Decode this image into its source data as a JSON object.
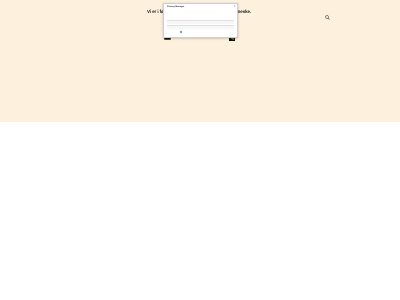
{
  "hero": {
    "headline_left": "Vi er i fø",
    "headline_right": "nneskе."
  },
  "contact": {
    "email": "",
    "phone": "",
    "extra": ""
  },
  "dialog": {
    "title": "Privacy Manager",
    "close": "×",
    "body": "",
    "option_1": "",
    "option_2": "",
    "footer_link": "",
    "check_state": "accepted"
  },
  "colors": {
    "hero_bg": "#fdf1dd",
    "accent": "#2e9e5b",
    "text": "#1a1a1a"
  },
  "icons": [
    "search-icon",
    "mail-icon",
    "phone-icon",
    "close-icon",
    "check-icon"
  ]
}
